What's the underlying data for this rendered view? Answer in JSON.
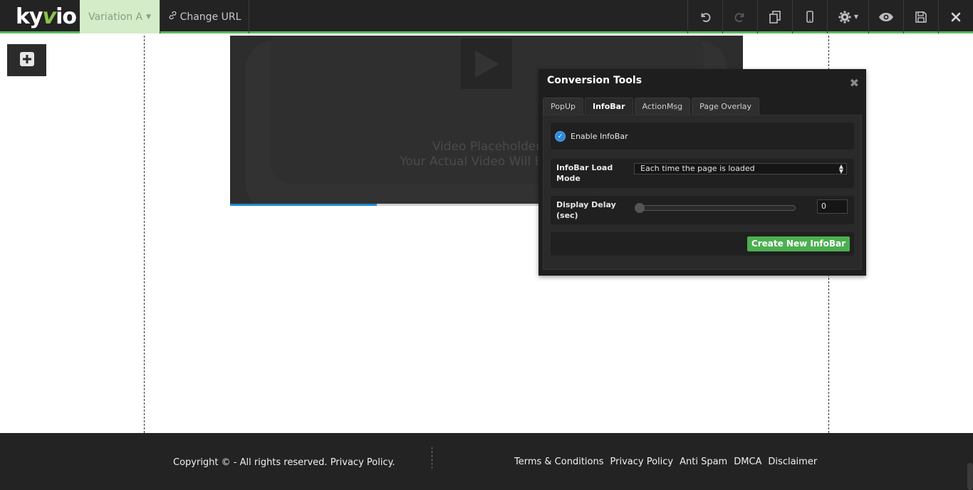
{
  "app": {
    "logo_text_a": "ky",
    "logo_text_v": "v",
    "logo_text_b": "io",
    "accent_color": "#5cb85c"
  },
  "toolbar": {
    "variation_label": "Variation A",
    "change_url_label": "Change URL",
    "icons": [
      "undo-icon",
      "redo-icon",
      "copy-icon",
      "mobile-icon",
      "gear-icon",
      "eye-icon",
      "save-icon",
      "close-icon"
    ]
  },
  "video": {
    "line1": "Video Placeholder",
    "line2": "Your Actual Video Will Be Dis",
    "progress_percent": 28.6
  },
  "conversion_tools": {
    "title": "Conversion Tools",
    "tabs": [
      {
        "label": "PopUp",
        "active": false
      },
      {
        "label": "InfoBar",
        "active": true
      },
      {
        "label": "ActionMsg",
        "active": false
      },
      {
        "label": "Page Overlay",
        "active": false
      }
    ],
    "enable_label": "Enable InfoBar",
    "enable_checked": true,
    "load_mode_label_1": "InfoBar Load",
    "load_mode_label_2": "Mode",
    "load_mode_value": "Each time the page is loaded",
    "delay_label_1": "Display Delay",
    "delay_label_2": "(sec)",
    "delay_value": "0",
    "delay_slider_fraction": 0,
    "create_button": "Create New InfoBar"
  },
  "footer": {
    "copyright": "Copyright © - All rights reserved. Privacy Policy.",
    "links": [
      "Terms & Conditions",
      "Privacy Policy",
      "Anti Spam",
      "DMCA",
      "Disclaimer"
    ]
  }
}
